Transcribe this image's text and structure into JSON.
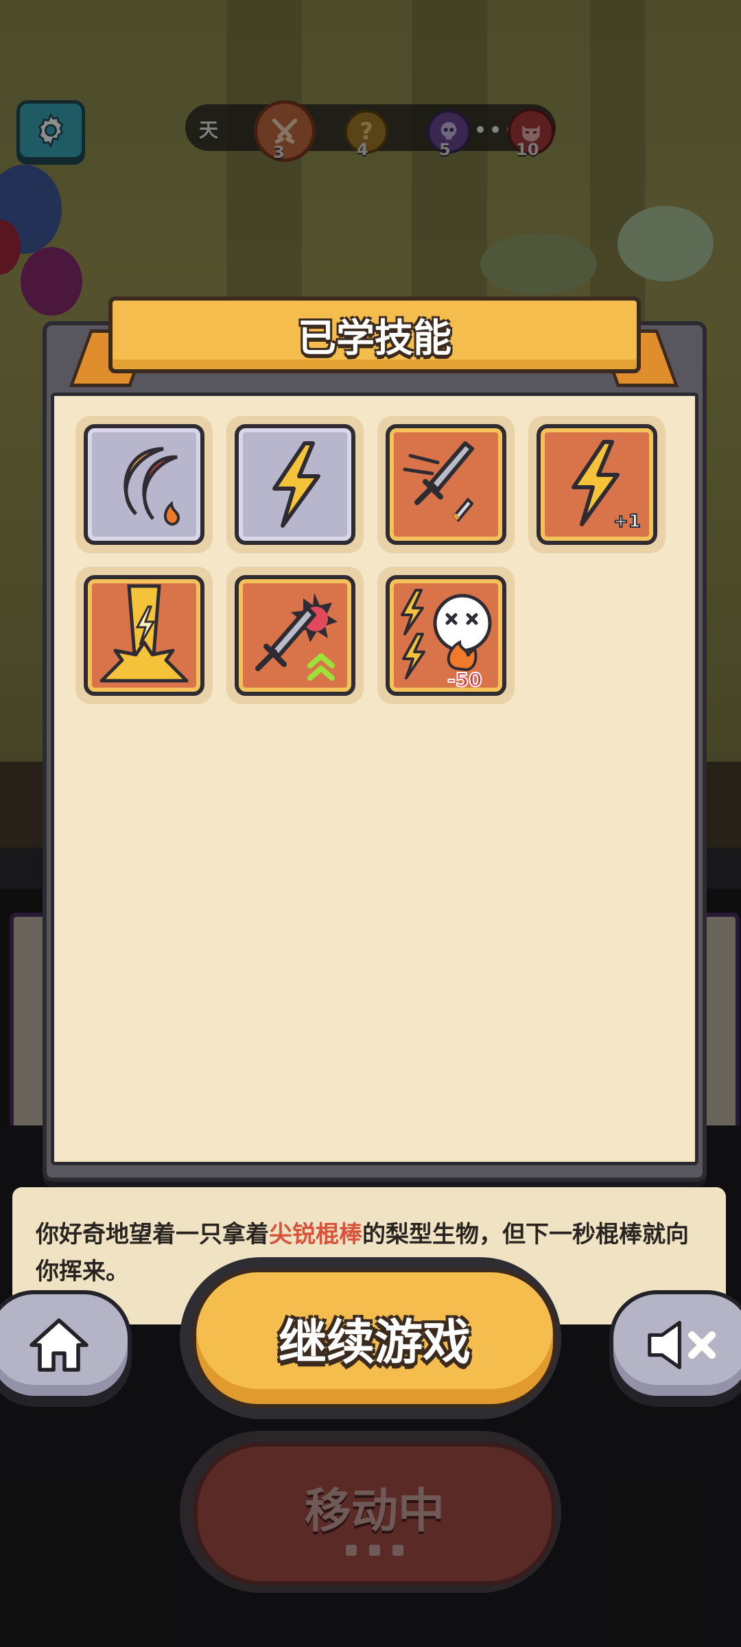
{
  "hud": {
    "day_label": "天",
    "stages": [
      {
        "icon": "crossed-swords-icon",
        "number": "3"
      },
      {
        "icon": "question-mark-icon",
        "number": "4"
      },
      {
        "icon": "skull-icon",
        "number": "5"
      },
      {
        "icon": "demon-mask-icon",
        "number": "10"
      }
    ],
    "ellipsis": "•••"
  },
  "modal": {
    "title": "已学技能",
    "skills": [
      {
        "icon": "crescent-flame-icon",
        "style": "grey"
      },
      {
        "icon": "lightning-icon",
        "style": "grey"
      },
      {
        "icon": "sword-dash-icon",
        "style": "orange"
      },
      {
        "icon": "lightning-plus-icon",
        "style": "orange",
        "badge": "+1"
      },
      {
        "icon": "lightning-beam-icon",
        "style": "orange"
      },
      {
        "icon": "sword-upgrade-icon",
        "style": "orange"
      },
      {
        "icon": "lightning-skull-icon",
        "style": "orange",
        "badge": "-50"
      }
    ]
  },
  "story": {
    "before": "你好奇地望着一只拿着",
    "highlight": "尖锐棍棒",
    "after": "的梨型生物，但下一秒棍棒就向你挥来。"
  },
  "buttons": {
    "continue_label": "继续游戏",
    "moving_label": "移动中",
    "home_icon": "home-icon",
    "mute_icon": "sound-muted-icon"
  },
  "colors": {
    "accent": "#f4bd4d",
    "panel": "#f5e6c8",
    "skill_orange": "#d9734a",
    "skill_grey": "#b8b6cc",
    "highlight_text": "#d8533a"
  }
}
